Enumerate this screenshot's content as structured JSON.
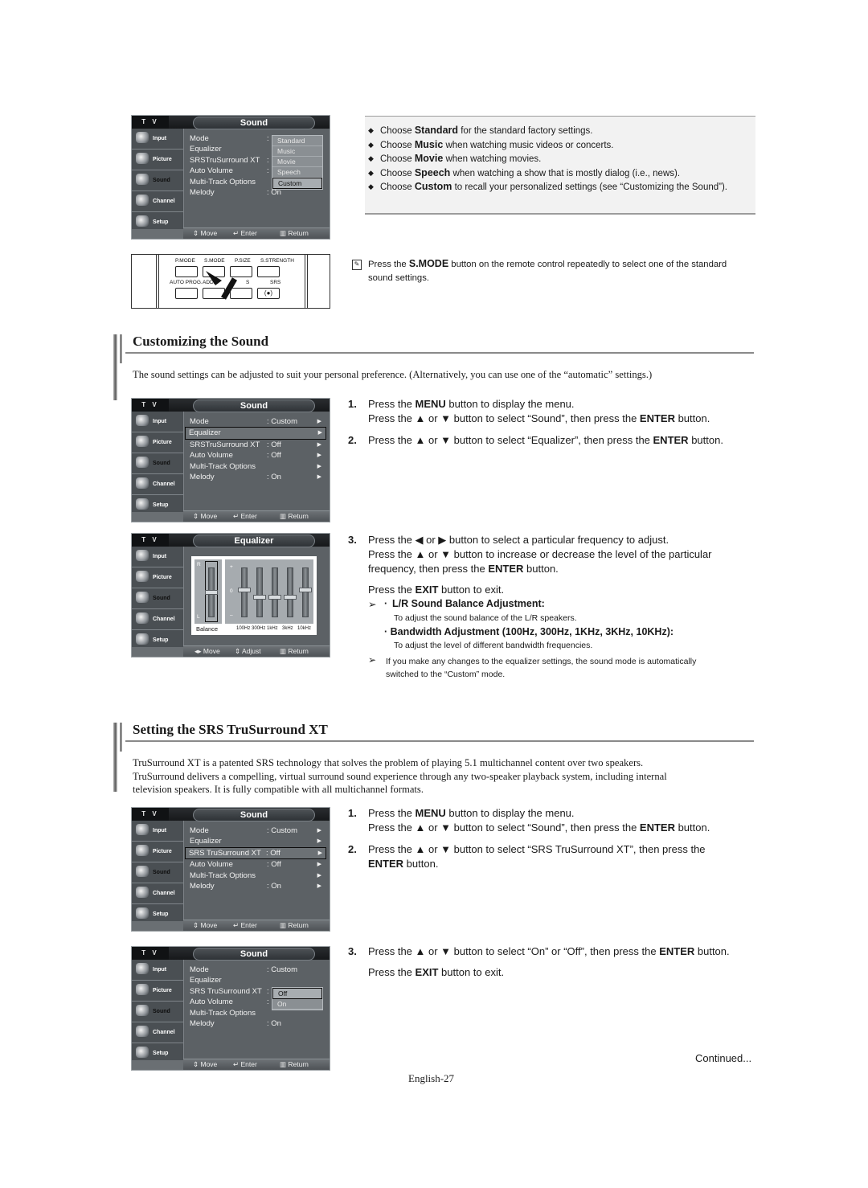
{
  "tv_menu_common": {
    "tv_label": "T V",
    "side_items": [
      "Input",
      "Picture",
      "Sound",
      "Channel",
      "Setup"
    ],
    "footer": {
      "move": "Move",
      "enter": "Enter",
      "return": "Return",
      "adjust": "Adjust"
    }
  },
  "panel1": {
    "title": "Sound",
    "rows": [
      {
        "label": "Mode",
        "value": ":"
      },
      {
        "label": "Equalizer",
        "value": ""
      },
      {
        "label": "SRSTruSurround XT",
        "value": ":"
      },
      {
        "label": "Auto Volume",
        "value": ":"
      },
      {
        "label": "Multi-Track Options",
        "value": ""
      },
      {
        "label": "Melody",
        "value": ": On"
      }
    ],
    "dropdown": [
      "Standard",
      "Music",
      "Movie",
      "Speech",
      "Custom"
    ],
    "dropdown_selected": "Custom"
  },
  "mode_bullets": [
    {
      "pre": "Choose ",
      "bold": "Standard",
      "post": " for the standard factory settings."
    },
    {
      "pre": "Choose ",
      "bold": "Music",
      "post": " when watching music videos or concerts."
    },
    {
      "pre": "Choose ",
      "bold": "Movie",
      "post": " when watching movies."
    },
    {
      "pre": "Choose ",
      "bold": "Speech",
      "post": " when watching a show that is mostly dialog (i.e., news)."
    },
    {
      "pre": "Choose ",
      "bold": "Custom",
      "post": " to recall your personalized settings (see “Customizing the Sound”)."
    }
  ],
  "remote": {
    "top_labels": [
      "P.MODE",
      "S.MODE",
      "P.SIZE",
      "S.STRENGTH"
    ],
    "bottom_labels": [
      "AUTO PROG.",
      "ADD/L",
      "S",
      "SRS"
    ]
  },
  "note_smode": {
    "pre": "Press the ",
    "bold": "S.MODE",
    "post": " button on the remote control repeatedly to select one of the standard sound settings."
  },
  "section1": {
    "heading": "Customizing the Sound",
    "intro": "The sound settings can be adjusted to suit your personal preference. (Alternatively, you can use one of the “automatic” settings.)"
  },
  "panel2": {
    "title": "Sound",
    "rows": [
      {
        "label": "Mode",
        "value": ": Custom"
      },
      {
        "label": "Equalizer",
        "value": ""
      },
      {
        "label": "SRSTruSurround XT",
        "value": ": Off"
      },
      {
        "label": "Auto Volume",
        "value": ": Off"
      },
      {
        "label": "Multi-Track Options",
        "value": ""
      },
      {
        "label": "Melody",
        "value": ": On"
      }
    ],
    "highlighted": "Equalizer"
  },
  "panel3": {
    "title": "Equalizer",
    "balance_label": "Balance",
    "balance_top": "R",
    "balance_bottom": "L",
    "plus": "+",
    "zero": "0",
    "minus": "–",
    "bands": [
      "100Hz",
      "300Hz",
      "1kHz",
      "3kHz",
      "10kHz"
    ],
    "band_levels": [
      0.1,
      -0.2,
      -0.2,
      -0.2,
      0.1
    ],
    "balance_level": 0
  },
  "steps1": [
    {
      "n": "1.",
      "lines": [
        "Press the <b>MENU</b> button to display the menu.",
        "Press the ▲ or ▼ button to select “Sound”, then press the <b>ENTER</b> button."
      ]
    },
    {
      "n": "2.",
      "lines": [
        "Press the ▲ or ▼ button to select “Equalizer”, then press the <b>ENTER</b> button."
      ]
    },
    {
      "n": "3.",
      "lines": [
        "Press the ◀ or ▶ button to select a particular frequency to adjust.",
        "Press the ▲ or ▼ button to increase or decrease the level of the particular",
        "frequency, then press the <b>ENTER</b> button."
      ]
    }
  ],
  "exit_line": "Press the EXIT button to exit.",
  "eq_notes": {
    "lr_title": "L/R Sound Balance Adjustment:",
    "lr_desc": "To adjust the sound balance of the L/R speakers.",
    "bw_title": "Bandwidth Adjustment (100Hz, 300Hz, 1KHz, 3KHz, 10KHz):",
    "bw_desc": "To adjust the level of different bandwidth frequencies.",
    "custom_note_1": "If you make any changes to the equalizer settings, the sound mode is automatically",
    "custom_note_2": "switched to the “Custom” mode."
  },
  "section2": {
    "heading": "Setting the SRS TruSurround XT",
    "intro_lines": [
      "TruSurround XT is a patented SRS technology that solves the problem of playing 5.1 multichannel content over two speakers.",
      "TruSurround delivers a compelling, virtual surround sound experience through any two-speaker playback system, including internal",
      "television speakers. It is fully compatible with all multichannel formats."
    ]
  },
  "panel4": {
    "title": "Sound",
    "rows": [
      {
        "label": "Mode",
        "value": ": Custom"
      },
      {
        "label": "Equalizer",
        "value": ""
      },
      {
        "label": "SRS TruSurround XT",
        "value": ": Off"
      },
      {
        "label": "Auto Volume",
        "value": ": Off"
      },
      {
        "label": "Multi-Track Options",
        "value": ""
      },
      {
        "label": "Melody",
        "value": ": On"
      }
    ],
    "highlighted": "SRS TruSurround XT"
  },
  "panel5": {
    "title": "Sound",
    "rows": [
      {
        "label": "Mode",
        "value": ": Custom"
      },
      {
        "label": "Equalizer",
        "value": ""
      },
      {
        "label": "SRS TruSurround XT",
        "value": ":"
      },
      {
        "label": "Auto Volume",
        "value": ":"
      },
      {
        "label": "Multi-Track Options",
        "value": ""
      },
      {
        "label": "Melody",
        "value": ": On"
      }
    ],
    "dropdown": [
      "Off",
      "On"
    ],
    "dropdown_selected": "Off"
  },
  "steps2": [
    {
      "n": "1.",
      "lines": [
        "Press the <b>MENU</b> button to display the menu.",
        "Press the ▲ or ▼ button to select “Sound”, then press the <b>ENTER</b> button."
      ]
    },
    {
      "n": "2.",
      "lines": [
        "Press the ▲ or ▼ button to select “SRS TruSurround XT”, then press the",
        "<b>ENTER</b> button."
      ]
    },
    {
      "n": "3.",
      "lines": [
        "Press the ▲ or ▼ button to select “On” or “Off”, then press the <b>ENTER</b> button.",
        "Press the <b>EXIT</b> button to exit."
      ]
    }
  ],
  "continued": "Continued...",
  "page_number": "English-27"
}
